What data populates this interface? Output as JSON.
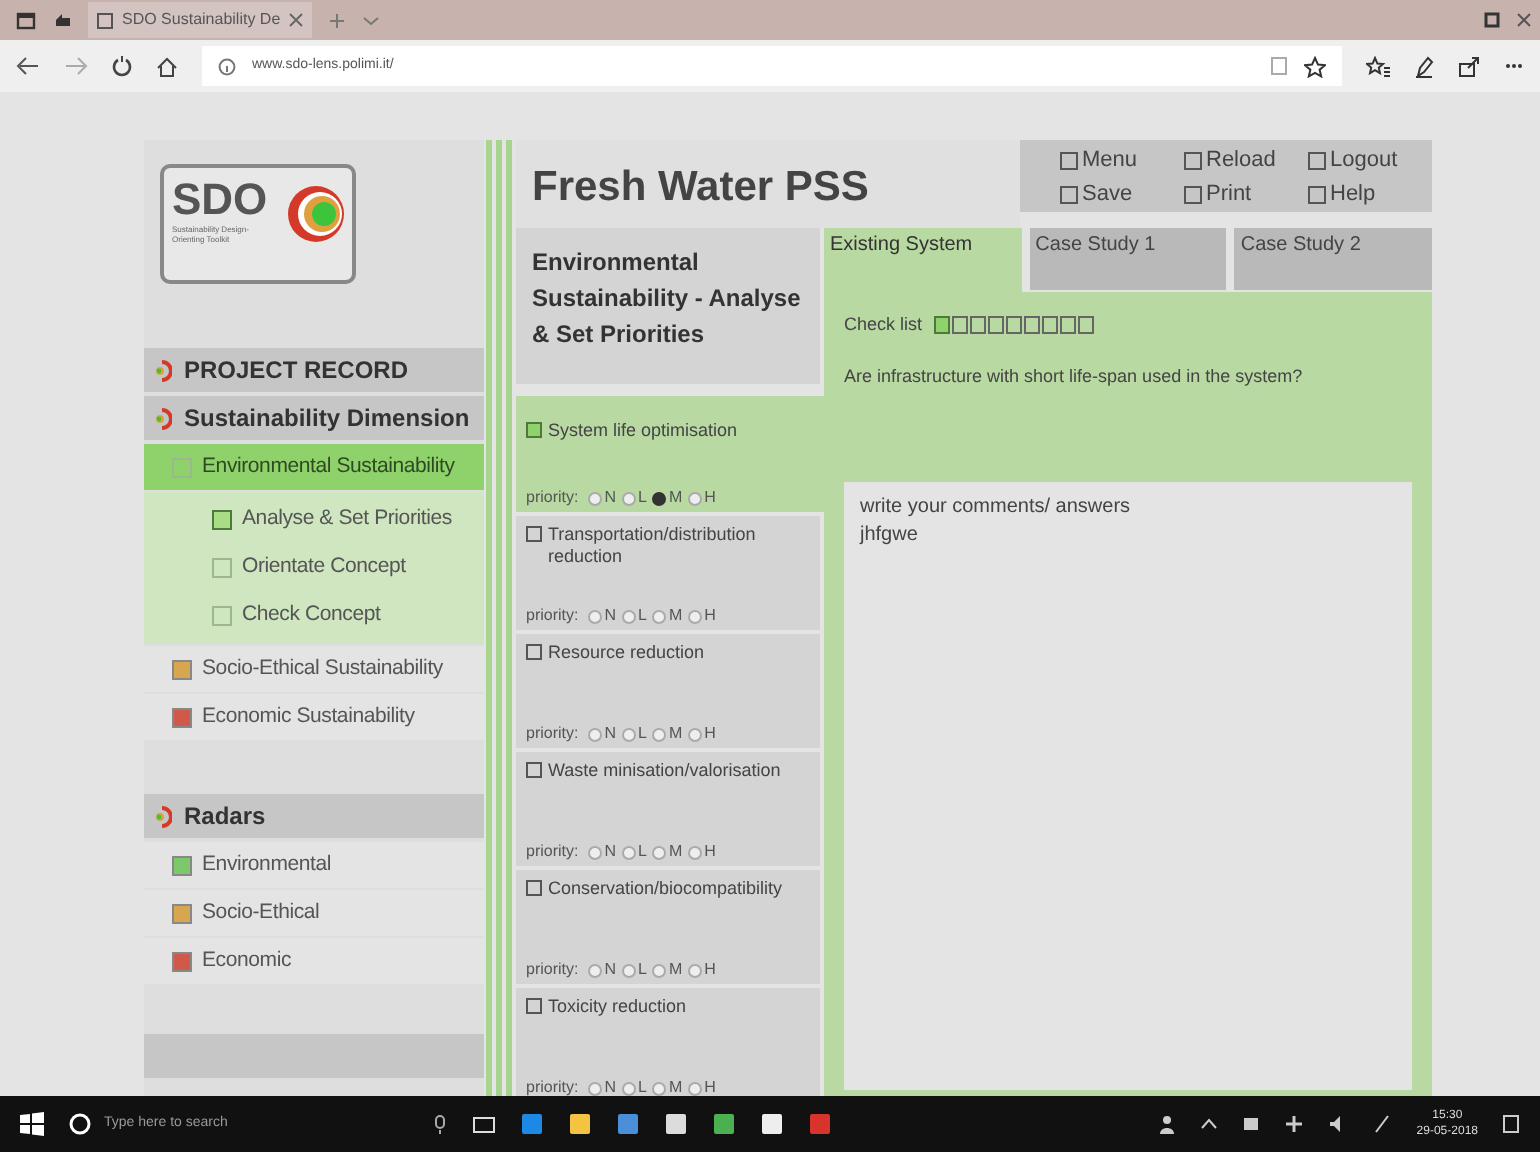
{
  "browser": {
    "tab_title": "SDO Sustainability De",
    "url": "www.sdo-lens.polimi.it/"
  },
  "logo": {
    "name": "SDO",
    "tagline": "Sustainability Design-Orienting Toolkit"
  },
  "sidebar": {
    "items": [
      {
        "kind": "section",
        "label": "PROJECT RECORD"
      },
      {
        "kind": "section",
        "label": "Sustainability Dimension",
        "children": [
          {
            "label": "Environmental Sustainability",
            "selected": true,
            "children": [
              {
                "label": "Analyse & Set Priorities",
                "selected": true
              },
              {
                "label": "Orientate Concept",
                "selected": false
              },
              {
                "label": "Check Concept",
                "selected": false
              }
            ]
          },
          {
            "label": "Socio-Ethical Sustainability",
            "selected": false,
            "color": "#d9a650"
          },
          {
            "label": "Economic Sustainability",
            "selected": false,
            "color": "#cf5a4a"
          }
        ]
      },
      {
        "kind": "section",
        "label": "Radars",
        "children": [
          {
            "label": "Environmental",
            "selected": false,
            "color": "#7cc86a"
          },
          {
            "label": "Socio-Ethical",
            "selected": false,
            "color": "#d9a650"
          },
          {
            "label": "Economic",
            "selected": false,
            "color": "#cf5a4a"
          }
        ]
      }
    ]
  },
  "title": "Fresh Water PSS",
  "actions": [
    "Menu",
    "Reload",
    "Logout",
    "Save",
    "Print",
    "Help"
  ],
  "heading": "Environmental Sustainability - Analyse & Set Priorities",
  "tabs": [
    {
      "label": "Existing System",
      "selected": true
    },
    {
      "label": "Case Study 1",
      "selected": false
    },
    {
      "label": "Case Study 2",
      "selected": false
    }
  ],
  "checklist": {
    "label": "Check list",
    "items": [
      {
        "checked": true
      },
      {
        "checked": false
      },
      {
        "checked": false
      },
      {
        "checked": false
      },
      {
        "checked": false
      },
      {
        "checked": false
      },
      {
        "checked": false
      },
      {
        "checked": false
      },
      {
        "checked": false
      }
    ]
  },
  "question": "Are infrastructure with short life-span used in the system?",
  "criteria": [
    {
      "label": "System life optimisation",
      "selected": true,
      "priority_label": "priority:",
      "options": [
        {
          "label": "N",
          "selected": false
        },
        {
          "label": "L",
          "selected": false
        },
        {
          "label": "M",
          "selected": true
        },
        {
          "label": "H",
          "selected": false
        }
      ]
    },
    {
      "label": "Transportation/distribution reduction",
      "selected": false,
      "priority_label": "priority:",
      "options": [
        {
          "label": "N",
          "selected": false
        },
        {
          "label": "L",
          "selected": false
        },
        {
          "label": "M",
          "selected": false
        },
        {
          "label": "H",
          "selected": false
        }
      ]
    },
    {
      "label": "Resource reduction",
      "selected": false,
      "priority_label": "priority:",
      "options": [
        {
          "label": "N",
          "selected": false
        },
        {
          "label": "L",
          "selected": false
        },
        {
          "label": "M",
          "selected": false
        },
        {
          "label": "H",
          "selected": false
        }
      ]
    },
    {
      "label": "Waste minisation/valorisation",
      "selected": false,
      "priority_label": "priority:",
      "options": [
        {
          "label": "N",
          "selected": false
        },
        {
          "label": "L",
          "selected": false
        },
        {
          "label": "M",
          "selected": false
        },
        {
          "label": "H",
          "selected": false
        }
      ]
    },
    {
      "label": "Conservation/biocompatibility",
      "selected": false,
      "priority_label": "priority:",
      "options": [
        {
          "label": "N",
          "selected": false
        },
        {
          "label": "L",
          "selected": false
        },
        {
          "label": "M",
          "selected": false
        },
        {
          "label": "H",
          "selected": false
        }
      ]
    },
    {
      "label": "Toxicity reduction",
      "selected": false,
      "priority_label": "priority:",
      "options": [
        {
          "label": "N",
          "selected": false
        },
        {
          "label": "L",
          "selected": false
        },
        {
          "label": "M",
          "selected": false
        },
        {
          "label": "H",
          "selected": false
        }
      ]
    }
  ],
  "comments": {
    "value": "write your comments/ answers\njhfgwe"
  },
  "taskbar": {
    "search_placeholder": "Type here to search",
    "time": "15:30",
    "date": "29-05-2018"
  }
}
